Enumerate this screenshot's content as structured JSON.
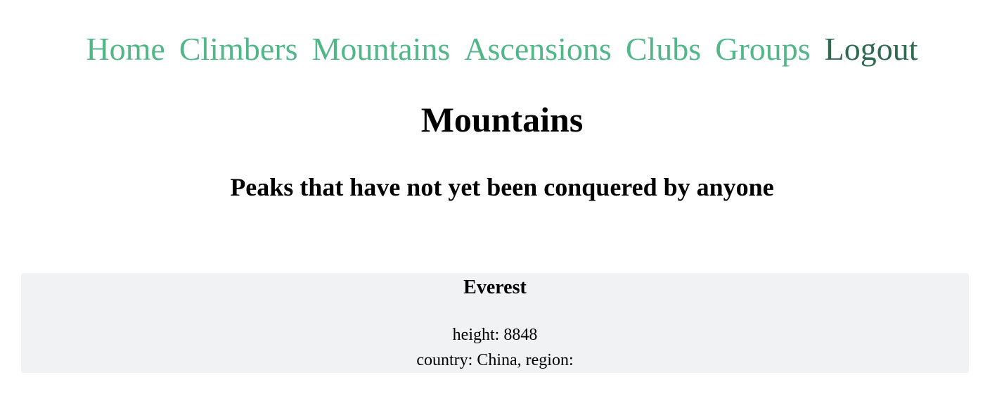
{
  "nav": {
    "items": [
      {
        "label": "Home"
      },
      {
        "label": "Climbers"
      },
      {
        "label": "Mountains"
      },
      {
        "label": "Ascensions"
      },
      {
        "label": "Clubs"
      },
      {
        "label": "Groups"
      }
    ],
    "logout_label": "Logout"
  },
  "page": {
    "title": "Mountains",
    "subtitle": "Peaks that have not yet been conquered by anyone"
  },
  "mountains": [
    {
      "name": "Everest",
      "height_line": "height: 8848",
      "location_line": "country: China, region:"
    }
  ],
  "colors": {
    "nav_link": "#52b788",
    "logout_link": "#2d6a4f",
    "card_background": "#f1f2f4"
  }
}
